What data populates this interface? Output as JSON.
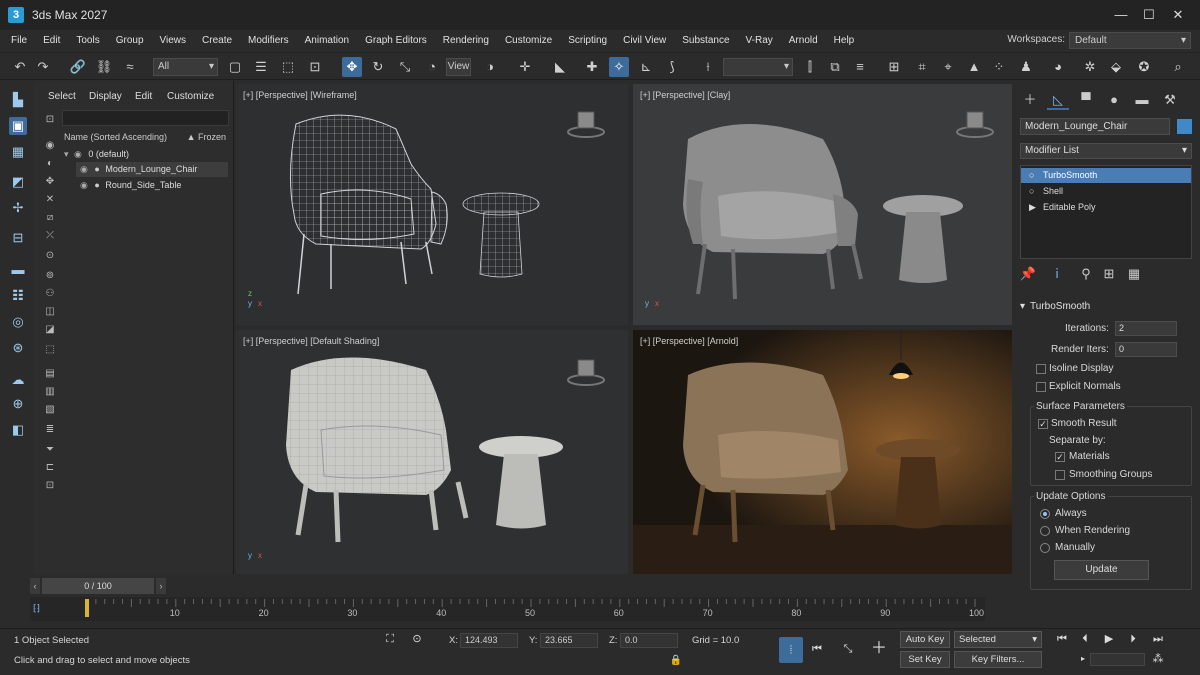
{
  "app": {
    "icon_text": "3",
    "title": "3ds Max 2027"
  },
  "window_controls": {
    "min": "—",
    "max": "☐",
    "close": "✕"
  },
  "menu": [
    "File",
    "Edit",
    "Tools",
    "Group",
    "Views",
    "Create",
    "Modifiers",
    "Animation",
    "Graph Editors",
    "Rendering",
    "Customize",
    "Scripting",
    "Civil View",
    "Substance",
    "V-Ray",
    "Arnold",
    "Help"
  ],
  "workspace": {
    "label": "Workspaces:",
    "value": "Default"
  },
  "toolbar": {
    "selection_filter": "All",
    "view_label": "View",
    "named_sets": ""
  },
  "scene_explorer": {
    "tabs": [
      "Select",
      "Display",
      "Edit",
      "Customize"
    ],
    "column_name": "Name (Sorted Ascending)",
    "column_frozen": "▲ Frozen",
    "tree": [
      {
        "label": "0 (default)",
        "selected": false
      },
      {
        "label": "Modern_Lounge_Chair",
        "selected": true
      },
      {
        "label": "Round_Side_Table",
        "selected": false
      }
    ]
  },
  "viewports": [
    {
      "label": "[+] [Perspective] [Wireframe]"
    },
    {
      "label": "[+] [Perspective] [Clay]"
    },
    {
      "label": "[+] [Perspective] [Default Shading]"
    },
    {
      "label": "[+] [Perspective] [Arnold]"
    }
  ],
  "command_panel": {
    "object_name": "Modern_Lounge_Chair",
    "object_color": "#3f89c9",
    "modifier_list": "Modifier List",
    "stack": [
      {
        "label": "TurboSmooth",
        "selected": true,
        "icon": "○"
      },
      {
        "label": "Shell",
        "selected": false,
        "icon": "○"
      },
      {
        "label": "Editable Poly",
        "selected": false,
        "icon": "▶"
      }
    ],
    "rollout_title": "TurboSmooth",
    "iterations_label": "Iterations:",
    "iterations_value": "2",
    "render_iters_label": "Render Iters:",
    "render_iters_value": "0",
    "isoline_display": "Isoline Display",
    "explicit_normals": "Explicit Normals",
    "surface_params": "Surface Parameters",
    "smooth_result": "Smooth Result",
    "separate_by": "Separate by:",
    "materials": "Materials",
    "smoothing_groups": "Smoothing Groups",
    "update_options": "Update Options",
    "always": "Always",
    "when_rendering": "When Rendering",
    "manually": "Manually",
    "update_button": "Update"
  },
  "timeline": {
    "frame_display": "0 / 100",
    "ticks": [
      "10",
      "20",
      "30",
      "40",
      "50",
      "60",
      "70",
      "80",
      "90",
      "100"
    ]
  },
  "status": {
    "selected_count": "1 Object Selected",
    "prompt": "Click and drag to select and move objects",
    "x_label": "X:",
    "x_value": "124.493",
    "y_label": "Y:",
    "y_value": "23.665",
    "z_label": "Z:",
    "z_value": "0.0",
    "grid": "Grid = 10.0",
    "auto_key": "Auto Key",
    "set_key": "Set Key",
    "selected_dropdown": "Selected",
    "key_filters": "Key Filters..."
  }
}
